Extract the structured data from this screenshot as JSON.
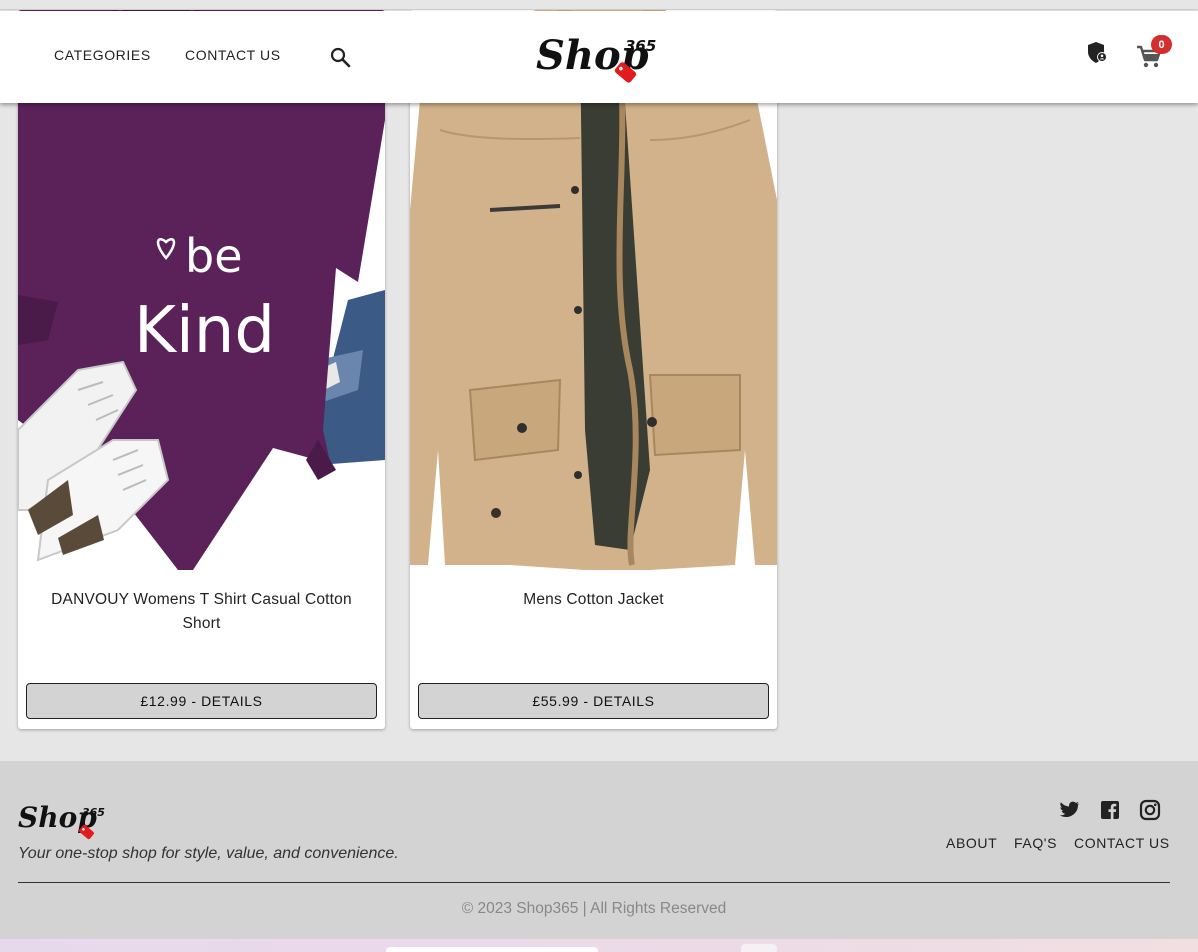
{
  "header": {
    "nav": [
      "CATEGORIES",
      "CONTACT US"
    ],
    "logo_text": "Shop",
    "logo_number": "365",
    "cart_count": "0"
  },
  "products": [
    {
      "name": "DANVOUY Womens T Shirt Casual Cotton Short",
      "button": "£12.99 - DETAILS",
      "print_line1": "be",
      "print_line2": "Kind"
    },
    {
      "name": "Mens Cotton Jacket",
      "button": "£55.99 - DETAILS"
    }
  ],
  "footer": {
    "logo_text": "Shop",
    "logo_number": "365",
    "tagline": "Your one-stop shop for style, value, and convenience.",
    "links": [
      "ABOUT",
      "FAQ'S",
      "CONTACT US"
    ],
    "social_icons": [
      "twitter-icon",
      "facebook-icon",
      "instagram-icon"
    ],
    "copyright": "© 2023 Shop365 | All Rights Reserved"
  },
  "colors": {
    "badge": "#d32f2f",
    "tshirt": "#5b2159",
    "jacket": "#d2b28a",
    "button_bg": "#d3d3d3",
    "footer_bg": "#d3d3d3"
  }
}
